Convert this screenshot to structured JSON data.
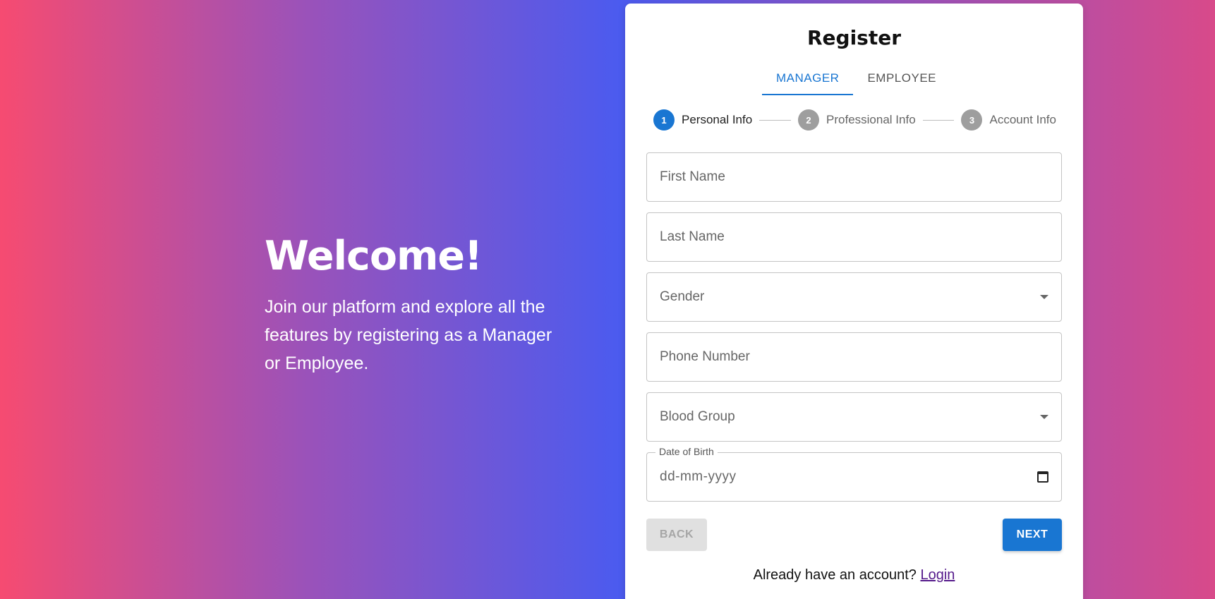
{
  "hero": {
    "title": "Welcome!",
    "description": "Join our platform and explore all the features by registering as a Manager or Employee."
  },
  "card": {
    "title": "Register",
    "tabs": [
      {
        "label": "MANAGER",
        "active": true
      },
      {
        "label": "EMPLOYEE",
        "active": false
      }
    ],
    "steps": [
      {
        "number": "1",
        "label": "Personal Info",
        "active": true
      },
      {
        "number": "2",
        "label": "Professional Info",
        "active": false
      },
      {
        "number": "3",
        "label": "Account Info",
        "active": false
      }
    ],
    "fields": {
      "first_name": {
        "placeholder": "First Name"
      },
      "last_name": {
        "placeholder": "Last Name"
      },
      "gender": {
        "placeholder": "Gender"
      },
      "phone": {
        "placeholder": "Phone Number"
      },
      "blood_group": {
        "placeholder": "Blood Group"
      },
      "dob": {
        "label": "Date of Birth",
        "placeholder": "dd-mm-yyyy"
      }
    },
    "buttons": {
      "back": "BACK",
      "next": "NEXT"
    },
    "footer": {
      "text": "Already have an account?",
      "link": "Login"
    }
  },
  "colors": {
    "primary": "#1976d2",
    "gradient_left": "#f64b71",
    "gradient_center": "#4b5bef",
    "gradient_right": "#d84a8a"
  }
}
